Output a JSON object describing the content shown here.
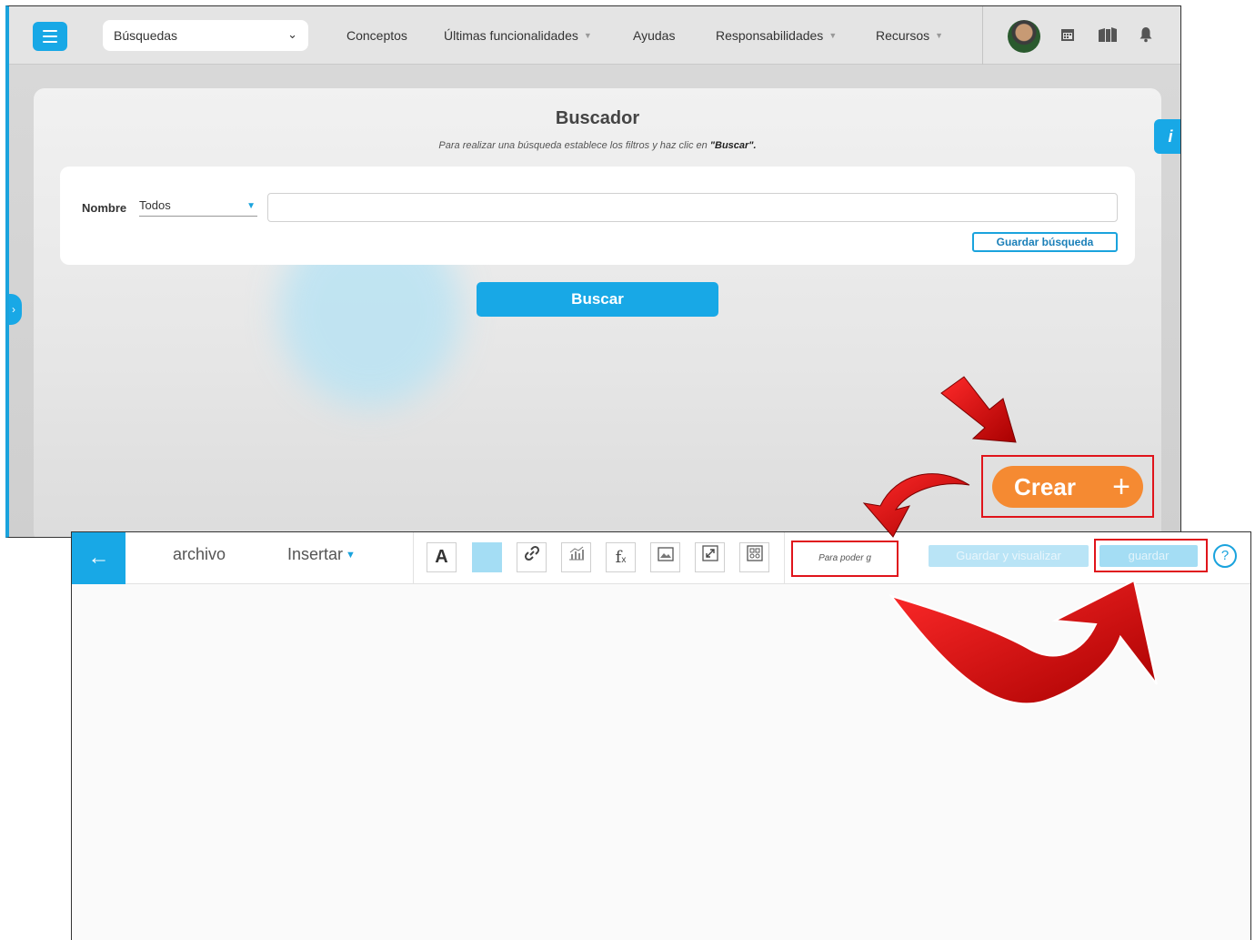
{
  "top": {
    "search_select": "Búsquedas",
    "nav": [
      "Conceptos",
      "Últimas funcionalidades",
      "Ayudas",
      "Responsabilidades",
      "Recursos"
    ],
    "panel": {
      "title": "Buscador",
      "subtitle_prefix": "Para realizar una búsqueda establece los filtros y haz clic en ",
      "subtitle_bold": "\"Buscar\".",
      "filter_label": "Nombre",
      "filter_value": "Todos",
      "save_search": "Guardar búsqueda",
      "search_button": "Buscar",
      "info": "i"
    },
    "create_button": "Crear",
    "create_plus": "+"
  },
  "editor": {
    "menu_file": "archivo",
    "menu_insert": "Insertar",
    "tools": [
      "A",
      "",
      "link-icon",
      "chart-icon",
      "fx",
      "image-icon",
      "resize-icon",
      "widgets-icon"
    ],
    "fx_label": "f",
    "fx_sub": "x",
    "hint": "Para poder g",
    "save_view": "Guardar y visualizar",
    "save": "guardar",
    "help": "?"
  },
  "colors": {
    "accent": "#18a8e6",
    "orange": "#f58a32",
    "highlight": "#e0141b"
  }
}
